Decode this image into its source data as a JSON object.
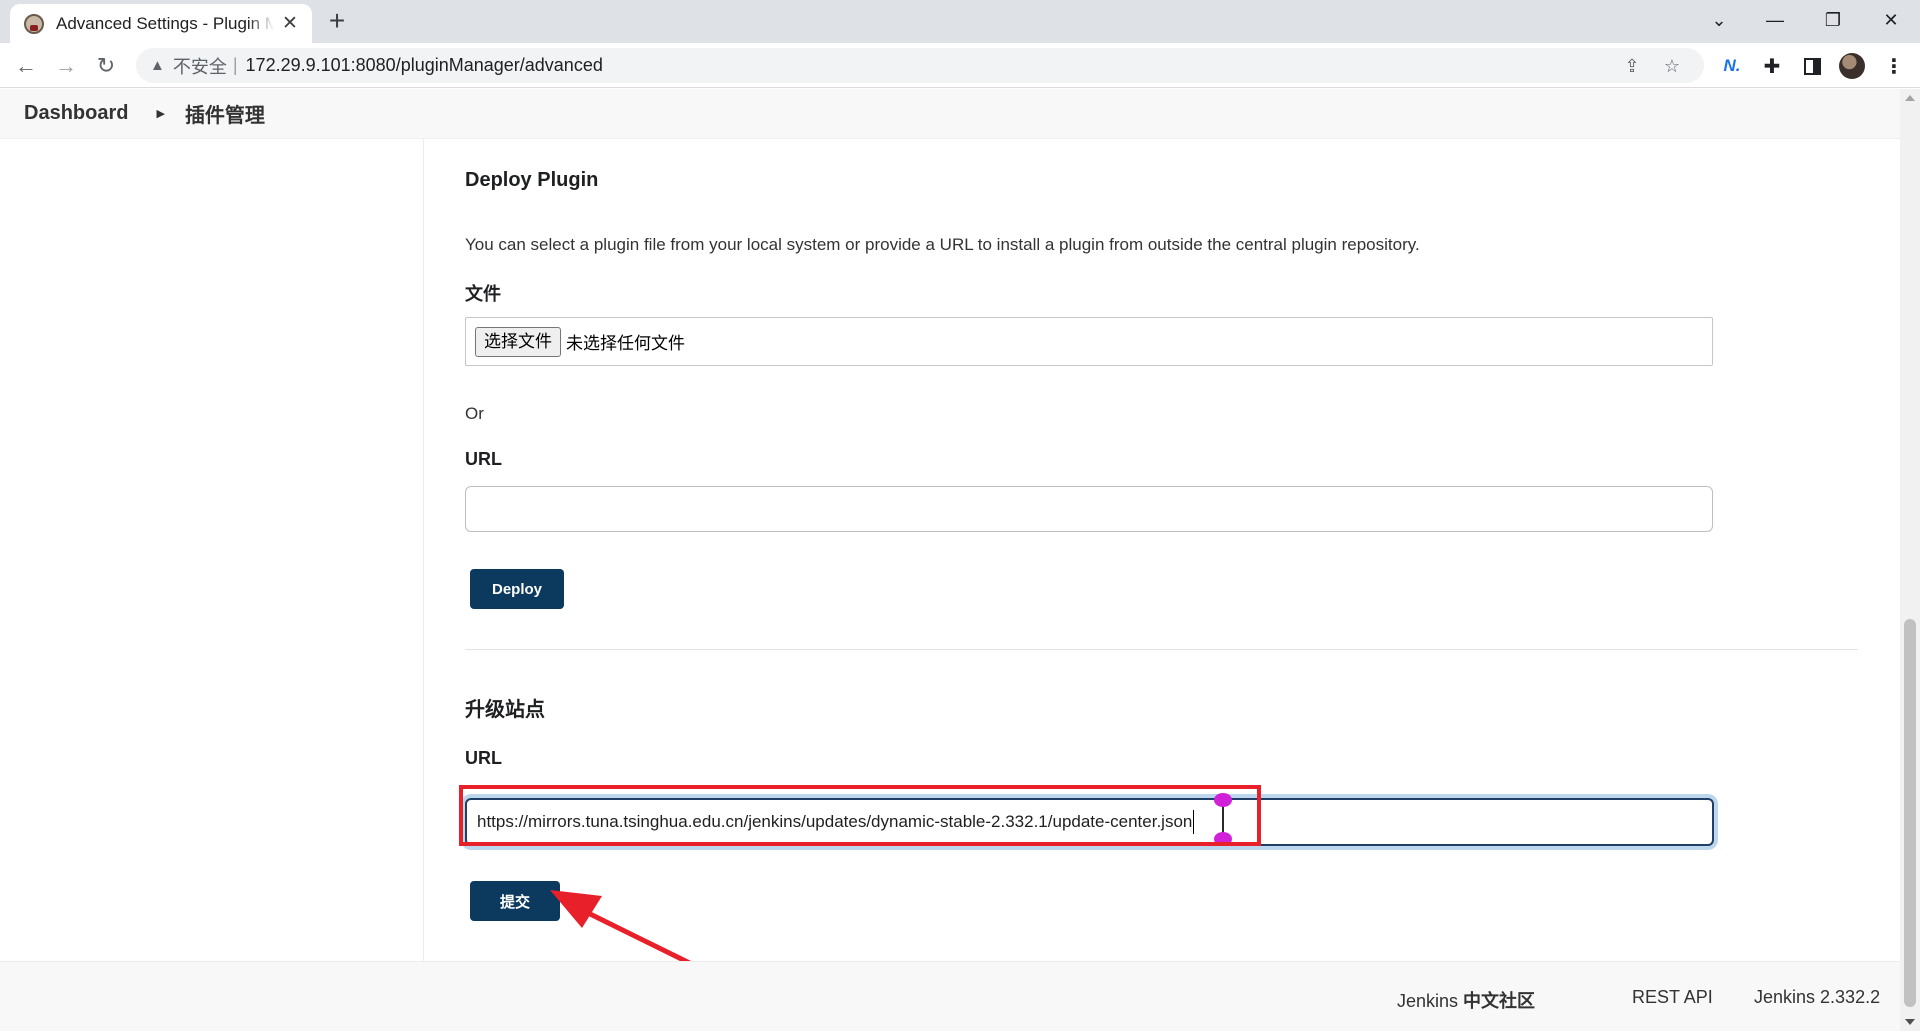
{
  "browser": {
    "tab_title": "Advanced Settings - Plugin Manager",
    "insecure_label": "不安全",
    "url": "172.29.9.101:8080/pluginManager/advanced"
  },
  "breadcrumb": {
    "items": [
      "Dashboard",
      "插件管理"
    ]
  },
  "deploy": {
    "title": "Deploy Plugin",
    "description": "You can select a plugin file from your local system or provide a URL to install a plugin from outside the central plugin repository.",
    "file_label": "文件",
    "file_button": "选择文件",
    "file_status": "未选择任何文件",
    "or_text": "Or",
    "url_label": "URL",
    "url_value": "",
    "button": "Deploy"
  },
  "update_site": {
    "title": "升级站点",
    "url_label": "URL",
    "url_value": "https://mirrors.tuna.tsinghua.edu.cn/jenkins/updates/dynamic-stable-2.332.1/update-center.json",
    "submit_button": "提交"
  },
  "footer": {
    "community_prefix": "Jenkins ",
    "community_bold": "中文社区",
    "rest_api": "REST API",
    "version": "Jenkins 2.332.2"
  },
  "colors": {
    "primary_button": "#0b3a5e",
    "annotation": "#e8202a",
    "selection_handle": "#d021d9"
  },
  "icons": [
    "back-arrow-icon",
    "forward-arrow-icon",
    "reload-icon",
    "warning-icon",
    "share-icon",
    "star-icon",
    "extension-n-icon",
    "puzzle-icon",
    "side-panel-icon",
    "profile-avatar",
    "more-menu-icon",
    "breadcrumb-arrow-icon"
  ]
}
